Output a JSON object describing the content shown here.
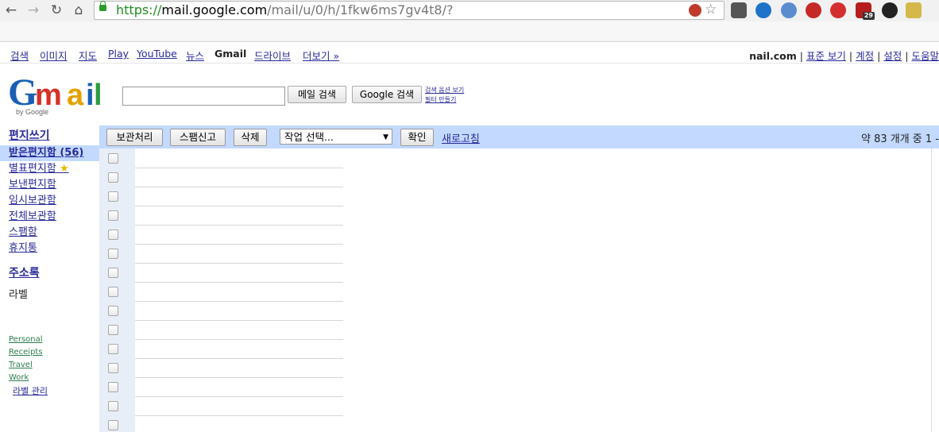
{
  "browser": {
    "url_https": "https://",
    "url_host": "mail.google.com",
    "url_path": "/mail/u/0/h/1fkw6ms7gv4t8/?",
    "ext_badge": "29"
  },
  "gbar": {
    "links": [
      "검색",
      "이미지",
      "지도",
      "Play",
      "YouTube",
      "뉴스"
    ],
    "current": "Gmail",
    "more": [
      "드라이브",
      "더보기 »"
    ],
    "email": "nail.com",
    "standard_view": "표준 보기",
    "account": "계정",
    "settings": "설정",
    "help": "도움말"
  },
  "header": {
    "logo_text": "Gmail",
    "logo_by": "by Google",
    "search_mail_button": "메일 검색",
    "search_web_button": "Google 검색",
    "search_options_link": "검색 옵션 보기",
    "create_filter_link": "필터 만들기"
  },
  "nav": {
    "compose": "편지쓰기",
    "inbox": "받은편지함 (56)",
    "starred": "별표편지함",
    "sent": "보낸편지함",
    "drafts": "임시보관함",
    "all_mail": "전체보관함",
    "spam": "스팸함",
    "trash": "휴지통",
    "contacts": "주소록",
    "labels_header": "라벨",
    "labels": [
      "Personal",
      "Receipts",
      "Travel",
      "Work"
    ],
    "manage_labels": "라벨 관리"
  },
  "toolbar": {
    "archive": "보관처리",
    "report_spam": "스팸신고",
    "delete": "삭제",
    "action_select": "작업 선택...",
    "confirm": "확인",
    "refresh": "새로고침",
    "count_text": "약 83 개개 중 1 -"
  },
  "colors": {
    "toolbar_bg": "#c3d9ff",
    "link": "#2a2a9a",
    "label_link": "#2e7d4f"
  }
}
